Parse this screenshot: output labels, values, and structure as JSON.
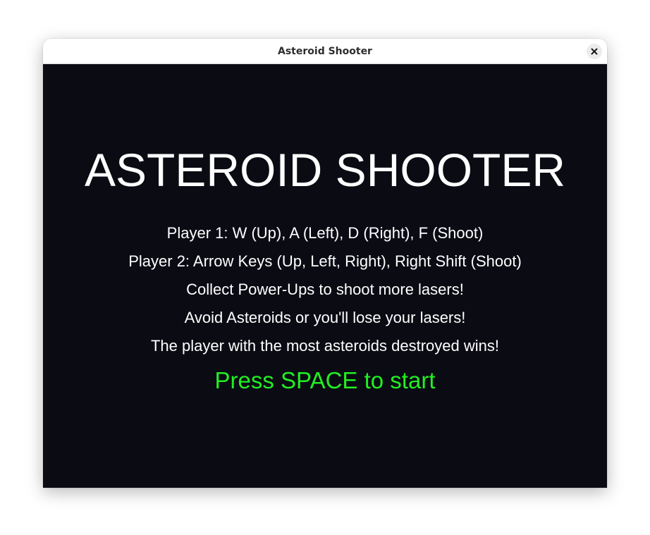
{
  "window": {
    "title": "Asteroid Shooter"
  },
  "game": {
    "title": "ASTEROID SHOOTER",
    "instructions": [
      "Player 1: W (Up), A (Left), D (Right), F (Shoot)",
      "Player 2: Arrow Keys (Up, Left, Right), Right Shift (Shoot)",
      "Collect Power-Ups to shoot more lasers!",
      "Avoid Asteroids or you'll lose your lasers!",
      "The player with the most asteroids destroyed wins!"
    ],
    "start_prompt": "Press SPACE to start"
  },
  "colors": {
    "background": "#0b0b14",
    "text": "#ffffff",
    "accent": "#22ee22"
  },
  "icons": {
    "close": "close-icon"
  }
}
